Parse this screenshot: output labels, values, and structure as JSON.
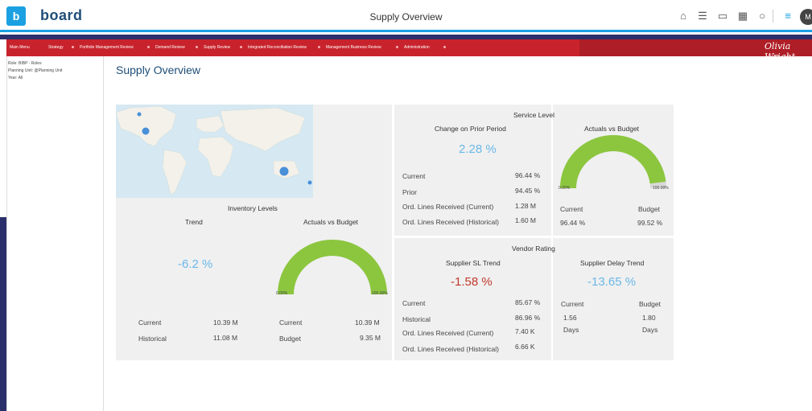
{
  "app": {
    "logo_letter": "b",
    "brand": "board",
    "window_title": "Supply Overview",
    "avatar": "M"
  },
  "toolbar_icons": [
    "home-icon",
    "hierarchy-icon",
    "layout-icon",
    "screen-icon",
    "comment-icon",
    "menu-icon"
  ],
  "menu": {
    "items": [
      "Main Menu",
      "Strategy",
      "Portfolio Management Review",
      "Demand Review",
      "Supply Review",
      "Integrated Reconciliation Review",
      "Management Business Review",
      "Administration"
    ],
    "brand_signature": "Olivia Wright"
  },
  "sidepanel": {
    "lines": [
      "Role: BIBP - Roles",
      "Planning Unit: @Planning Unit",
      "Year: All"
    ]
  },
  "page": {
    "title": "Supply Overview"
  },
  "inventory": {
    "title": "Inventory Levels",
    "trend_label": "Trend",
    "trend_value": "-6.2 %",
    "avb_label": "Actuals vs Budget",
    "gauge_min": "0.00%",
    "gauge_max": "100.00%",
    "gauge_fill": 1.0,
    "rows_left": [
      {
        "label": "Current",
        "value": "10.39 M"
      },
      {
        "label": "Historical",
        "value": "11.08 M"
      }
    ],
    "rows_right": [
      {
        "label": "Current",
        "value": "10.39 M"
      },
      {
        "label": "Budget",
        "value": "9.35 M"
      }
    ]
  },
  "service": {
    "title": "Service Level",
    "cpp_label": "Change on Prior Period",
    "cpp_value": "2.28 %",
    "avb_label": "Actuals vs Budget",
    "gauge_min": "0.00%",
    "gauge_max": "100.00%",
    "gauge_fill": 0.96,
    "rows": [
      {
        "label": "Current",
        "value": "96.44 %"
      },
      {
        "label": "Prior",
        "value": "94.45 %"
      },
      {
        "label": "Ord. Lines Received (Current)",
        "value": "1.28 M"
      },
      {
        "label": "Ord. Lines Received (Historical)",
        "value": "1.60 M"
      }
    ],
    "avb_headers": [
      "Current",
      "Budget"
    ],
    "avb_values": [
      "96.44 %",
      "99.52 %"
    ]
  },
  "vendor": {
    "title": "Vendor Rating",
    "sl_label": "Supplier SL Trend",
    "sl_value": "-1.58 %",
    "delay_label": "Supplier Delay Trend",
    "delay_value": "-13.65 %",
    "rows": [
      {
        "label": "Current",
        "value": "85.67 %"
      },
      {
        "label": "Historical",
        "value": "86.96 %"
      },
      {
        "label": "Ord. Lines Received (Current)",
        "value": "7.40 K"
      },
      {
        "label": "Ord. Lines Received (Historical)",
        "value": "6.66 K"
      }
    ],
    "delay_headers": [
      "Current",
      "Budget"
    ],
    "delay_values": [
      "1.56",
      "1.80"
    ],
    "delay_units": [
      "Days",
      "Days"
    ]
  },
  "colors": {
    "accent": "#1ba1e2",
    "menu": "#c8232c",
    "navy": "#2b2f6b",
    "gauge": "#8cc63f",
    "positive": "#6ab8e8",
    "negative": "#c0392b"
  }
}
